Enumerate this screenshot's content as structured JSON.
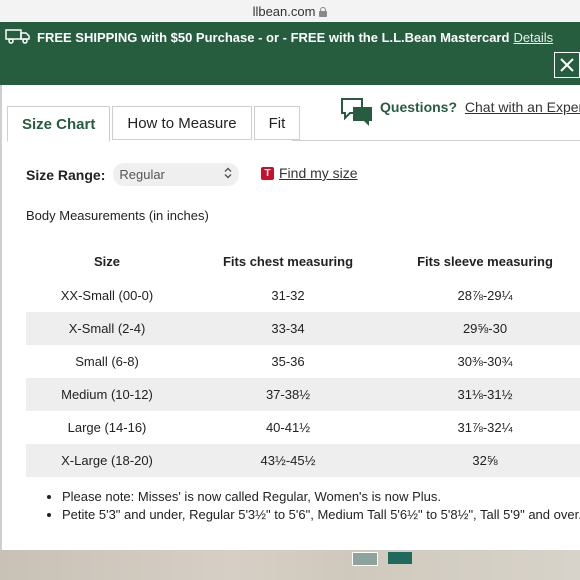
{
  "browser": {
    "url": "llbean.com"
  },
  "promo": {
    "text": "FREE SHIPPING with $50 Purchase - or - FREE with the L.L.Bean Mastercard",
    "details_link": "Details"
  },
  "tabs": [
    {
      "label": "Size Chart",
      "active": true
    },
    {
      "label": "How to Measure",
      "active": false
    },
    {
      "label": "Fit",
      "active": false
    }
  ],
  "questions": {
    "label": "Questions?",
    "link": "Chat with an Expert"
  },
  "size_range": {
    "label": "Size Range:",
    "selected": "Regular"
  },
  "find_my_size": {
    "badge": "T",
    "link": "Find my size"
  },
  "section_title": "Body Measurements (in inches)",
  "table": {
    "headers": [
      "Size",
      "Fits chest measuring",
      "Fits sleeve measuring"
    ],
    "rows": [
      [
        "XX-Small (00-0)",
        "31-32",
        "28⅞-29¼"
      ],
      [
        "X-Small (2-4)",
        "33-34",
        "29⅝-30"
      ],
      [
        "Small (6-8)",
        "35-36",
        "30⅜-30¾"
      ],
      [
        "Medium (10-12)",
        "37-38½",
        "31⅛-31½"
      ],
      [
        "Large (14-16)",
        "40-41½",
        "31⅞-32¼"
      ],
      [
        "X-Large (18-20)",
        "43½-45½",
        "32⅝"
      ]
    ]
  },
  "notes": [
    "Please note: Misses' is now called Regular, Women's is now Plus.",
    "Petite 5'3\" and under, Regular 5'3½\" to 5'6\", Medium Tall 5'6½\" to 5'8½\", Tall 5'9\" and over."
  ],
  "colors": {
    "brand_green": "#275d3f",
    "row_shade": "#eeeeee",
    "find_badge": "#c8102e"
  }
}
